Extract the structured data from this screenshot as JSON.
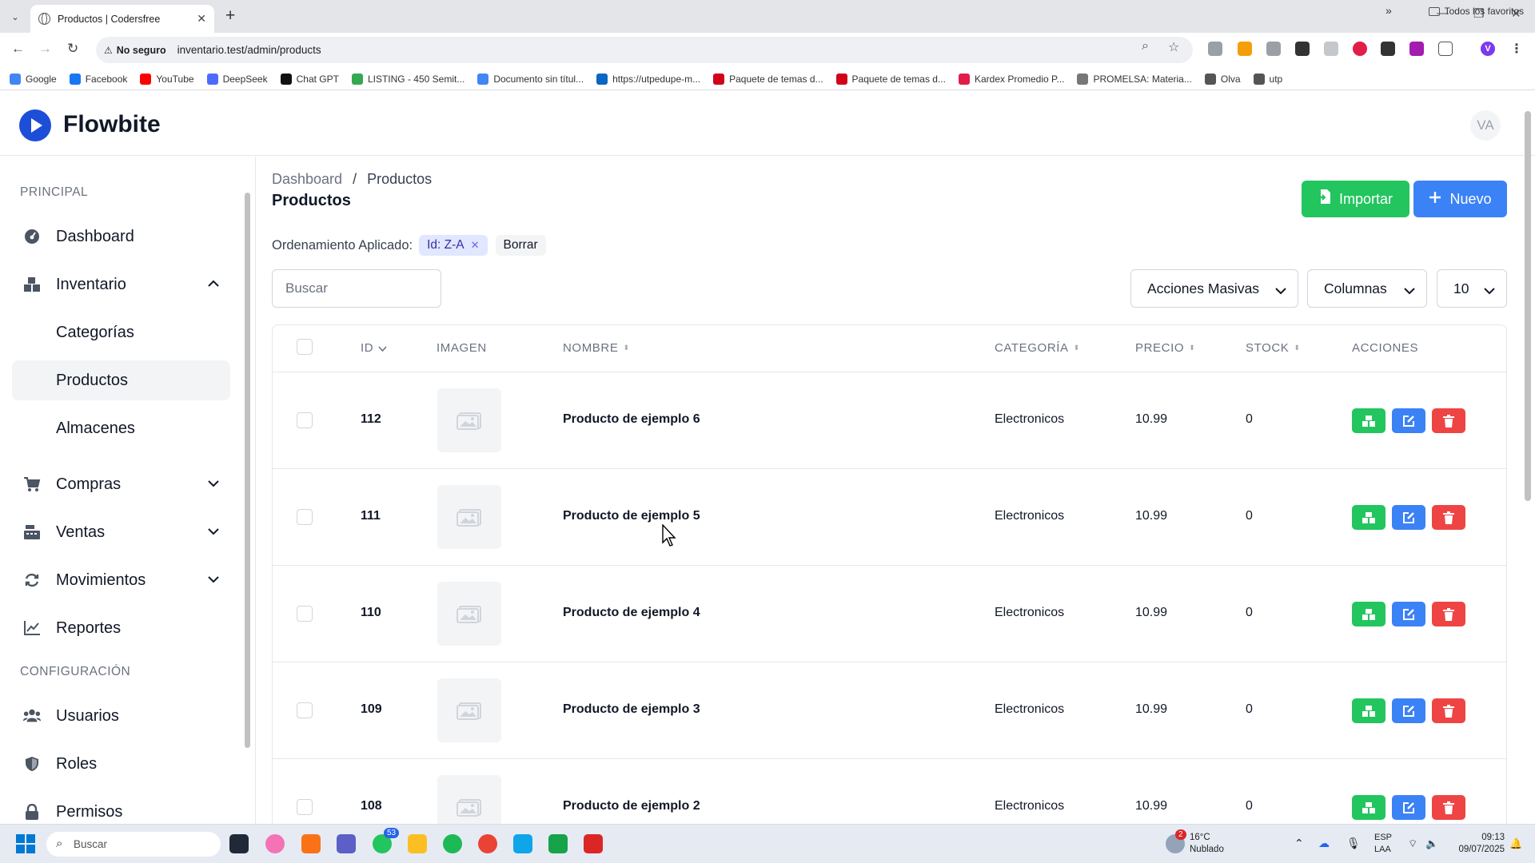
{
  "browser": {
    "tab_title": "Productos | Codersfree",
    "security_label": "No seguro",
    "url": "inventario.test/admin/products",
    "bookmarks": [
      {
        "label": "Google",
        "color": "#4285f4"
      },
      {
        "label": "Facebook",
        "color": "#1877f2"
      },
      {
        "label": "YouTube",
        "color": "#ff0000"
      },
      {
        "label": "DeepSeek",
        "color": "#4d6bfe"
      },
      {
        "label": "Chat GPT",
        "color": "#111111"
      },
      {
        "label": "LISTING - 450 Semit...",
        "color": "#34a853"
      },
      {
        "label": "Documento sin títul...",
        "color": "#4285f4"
      },
      {
        "label": "https://utpedupe-m...",
        "color": "#0a66c2"
      },
      {
        "label": "Paquete de temas d...",
        "color": "#d0021b"
      },
      {
        "label": "Paquete de temas d...",
        "color": "#d0021b"
      },
      {
        "label": "Kardex Promedio P...",
        "color": "#e11d48"
      },
      {
        "label": "PROMELSA: Materia...",
        "color": "#777777"
      },
      {
        "label": "Olva",
        "color": "#555555"
      },
      {
        "label": "utp",
        "color": "#555555"
      }
    ],
    "all_bookmarks": "Todos los favoritos"
  },
  "app": {
    "brand": "Flowbite",
    "avatar_initials": "VA",
    "accent": "#3b82f6",
    "success": "#22c55e",
    "danger": "#ef4444"
  },
  "sidebar": {
    "section_main": "PRINCIPAL",
    "dashboard": "Dashboard",
    "inventario": "Inventario",
    "categorias": "Categorías",
    "productos": "Productos",
    "almacenes": "Almacenes",
    "compras": "Compras",
    "ventas": "Ventas",
    "movimientos": "Movimientos",
    "reportes": "Reportes",
    "section_config": "CONFIGURACIÓN",
    "usuarios": "Usuarios",
    "roles": "Roles",
    "permisos": "Permisos"
  },
  "main": {
    "breadcrumb_root": "Dashboard",
    "breadcrumb_sep": "/",
    "breadcrumb_current": "Productos",
    "title": "Productos",
    "import_label": "Importar",
    "new_label": "Nuevo",
    "sort_label": "Ordenamiento Aplicado:",
    "sort_chip": "Id: Z-A",
    "clear_label": "Borrar",
    "search_placeholder": "Buscar",
    "bulk_actions": "Acciones Masivas",
    "columns": "Columnas",
    "per_page": "10"
  },
  "table": {
    "headers": {
      "id": "ID",
      "image": "IMAGEN",
      "name": "NOMBRE",
      "category": "CATEGORÍA",
      "price": "PRECIO",
      "stock": "STOCK",
      "actions": "ACCIONES"
    },
    "rows": [
      {
        "id": "112",
        "name": "Producto de ejemplo 6",
        "category": "Electronicos",
        "price": "10.99",
        "stock": "0"
      },
      {
        "id": "111",
        "name": "Producto de ejemplo 5",
        "category": "Electronicos",
        "price": "10.99",
        "stock": "0"
      },
      {
        "id": "110",
        "name": "Producto de ejemplo 4",
        "category": "Electronicos",
        "price": "10.99",
        "stock": "0"
      },
      {
        "id": "109",
        "name": "Producto de ejemplo 3",
        "category": "Electronicos",
        "price": "10.99",
        "stock": "0"
      },
      {
        "id": "108",
        "name": "Producto de ejemplo 2",
        "category": "Electronicos",
        "price": "10.99",
        "stock": "0"
      }
    ]
  },
  "taskbar": {
    "search_placeholder": "Buscar",
    "weather_temp": "16°C",
    "weather_desc": "Nublado",
    "weather_badge": "2",
    "whatsapp_badge": "53",
    "lang_top": "ESP",
    "lang_bottom": "LAA",
    "time": "09:13",
    "date": "09/07/2025"
  }
}
